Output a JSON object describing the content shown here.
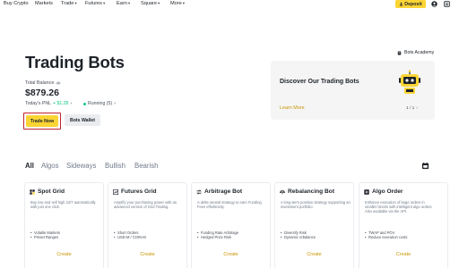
{
  "nav": {
    "items": [
      {
        "label": "Buy Crypto",
        "caret": false
      },
      {
        "label": "Markets",
        "caret": false
      },
      {
        "label": "Trade",
        "caret": true
      },
      {
        "label": "Futures",
        "caret": true
      },
      {
        "label": "Earn",
        "caret": true
      },
      {
        "label": "Square",
        "caret": true
      },
      {
        "label": "More",
        "caret": true
      }
    ],
    "deposit_label": "Deposit",
    "caret": "▾"
  },
  "hero": {
    "title": "Trading Bots",
    "total_balance_label": "Total Balance",
    "total_balance_value": "$879.26",
    "pnl_label": "Today's PNL",
    "pnl_value": "+ $1.28",
    "running_label": "Running (5)",
    "trade_now_label": "Trade Now",
    "bots_wallet_label": "Bots Wallet"
  },
  "promo": {
    "academy_label": "Bots Academy",
    "title": "Discover Our Trading Bots",
    "learn_more": "Learn More",
    "pager": "1 / 1"
  },
  "tabs": [
    {
      "label": "All",
      "active": true
    },
    {
      "label": "Algos",
      "active": false
    },
    {
      "label": "Sideways",
      "active": false
    },
    {
      "label": "Bullish",
      "active": false
    },
    {
      "label": "Bearish",
      "active": false
    }
  ],
  "cards": [
    {
      "name": "Spot Grid",
      "icon": "spot-grid-icon",
      "desc": "Buy low and sell high 24/7 automatically with just one click.",
      "bullets": [
        "Volatile Markets",
        "Preset Ranges"
      ],
      "create": "Create"
    },
    {
      "name": "Futures Grid",
      "icon": "futures-grid-icon",
      "desc": "Amplify your purchasing power with an advanced version of Grid Trading.",
      "bullets": [
        "Short Orders",
        "USD-M / COIN-M"
      ],
      "create": "Create"
    },
    {
      "name": "Arbitrage Bot",
      "icon": "arbitrage-bot-icon",
      "desc": "A delta neutral strategy to earn Funding Fees effortlessly.",
      "bullets": [
        "Funding Rate Arbitrage",
        "Hedged Price Risk"
      ],
      "create": "Create"
    },
    {
      "name": "Rebalancing Bot",
      "icon": "rebalancing-bot-icon",
      "desc": "A long-term position strategy supporting an investment portfolio.",
      "bullets": [
        "Diversify Risk",
        "Dynamic rebalance"
      ],
      "create": "Create"
    },
    {
      "name": "Algo Order",
      "icon": "algo-order-icon",
      "desc": "Enhance execution of large orders in smaller blocks with intelligent algo orders. Also available via the API.",
      "bullets": [
        "TWAP and POV",
        "Reduce execution costs"
      ],
      "create": "Create"
    }
  ],
  "colors": {
    "brand_yellow": "#fcd535",
    "link_gold": "#c99400",
    "positive_green": "#0ecb81",
    "highlight_red": "#c0232c"
  }
}
